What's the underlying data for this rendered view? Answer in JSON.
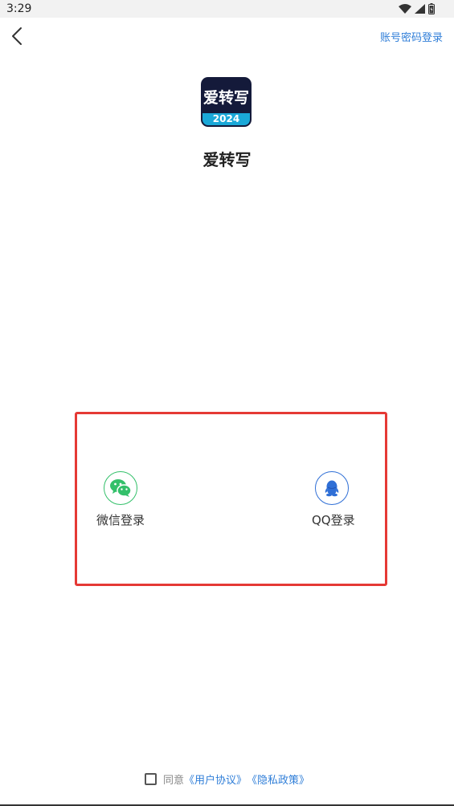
{
  "status_bar": {
    "time": "3:29"
  },
  "header": {
    "alt_login_label": "账号密码登录"
  },
  "app": {
    "logo_text": "爱转写",
    "logo_year": "2024",
    "name": "爱转写"
  },
  "login_options": [
    {
      "label": "微信登录",
      "icon": "wechat-icon",
      "color": "#33c06a"
    },
    {
      "label": "QQ登录",
      "icon": "qq-icon",
      "color": "#2f6fd6"
    }
  ],
  "agreement": {
    "prefix": "同意",
    "user_agreement": "《用户协议》",
    "privacy_policy": "《隐私政策》"
  }
}
